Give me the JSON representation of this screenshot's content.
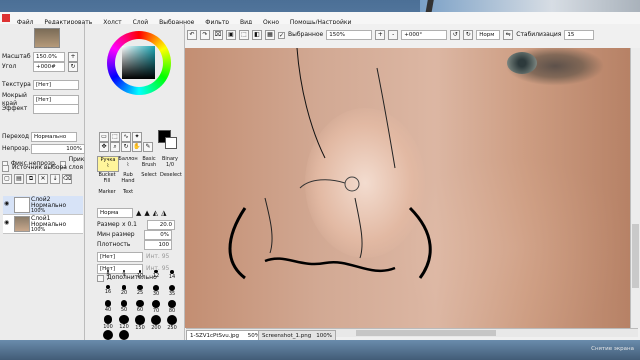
{
  "menu": [
    "Файл",
    "Редактировать",
    "Холст",
    "Слой",
    "Выбранное",
    "Фильтр",
    "Вид",
    "Окно",
    "Помощь/Настройки"
  ],
  "navigator": {
    "zoom_label": "Масштаб",
    "zoom_value": "150.0%",
    "angle_label": "Угол",
    "angle_value": "+000#"
  },
  "layer_props": {
    "texture_label": "Текстура",
    "texture_value": "[Нет]",
    "wet_label": "Мокрый край",
    "wet_value": "[Нет]",
    "effect_label": "Эффект",
    "effect_value": "",
    "blend_label": "Переход",
    "blend_value": "Нормально",
    "opacity_label": "Непрозр.",
    "opacity_value": "100%"
  },
  "checkboxes": {
    "fix_opacity": "Фикс.непрозр.",
    "clip_group": "Прикрепление слоя",
    "select_source": "Источник выбора"
  },
  "layers": [
    {
      "name": "Слой2",
      "mode": "Нормально",
      "pct": "100%"
    },
    {
      "name": "Слой1",
      "mode": "Нормально",
      "pct": "100%"
    }
  ],
  "tools": [
    "Ручка",
    "Баллон",
    "Basic Brush",
    "Binary 1/0",
    "Bucket Fill",
    "Rub Hand",
    "Select",
    "Deselect",
    "Marker",
    "Text"
  ],
  "brush": {
    "mode": "Норма",
    "size_label": "Размер",
    "size_mult": "x 0.1",
    "size_value": "20.0",
    "min_label": "Мин размер",
    "min_value": "0%",
    "density_label": "Плотность",
    "density_value": "100",
    "tex_a": "[Нет]",
    "tex_a_v": "Инт. 95",
    "tex_b": "[Нет]",
    "tex_b_v": "Инт. 95",
    "add_label": "Дополнительно"
  },
  "brush_sizes": [
    "8",
    "9",
    "10",
    "12",
    "14",
    "16",
    "20",
    "25",
    "30",
    "35",
    "40",
    "50",
    "60",
    "70",
    "80",
    "100",
    "120",
    "150",
    "200",
    "250",
    "300",
    "350"
  ],
  "topbar": {
    "mode_label": "Выбранное",
    "zoom": "150%",
    "rot": "+000°",
    "norm": "Норм",
    "smooth_label": "Стабилизация",
    "smooth_value": "15"
  },
  "tabs": [
    {
      "name": "1-SZV1cPtSvu.jpg",
      "pct": "50%"
    },
    {
      "name": "Screenshot_1.png",
      "pct": "100%"
    }
  ],
  "taskbar": {
    "info": "Снятие экрана"
  },
  "colors": {
    "primary": "#000000",
    "secondary": "#ffffff"
  }
}
